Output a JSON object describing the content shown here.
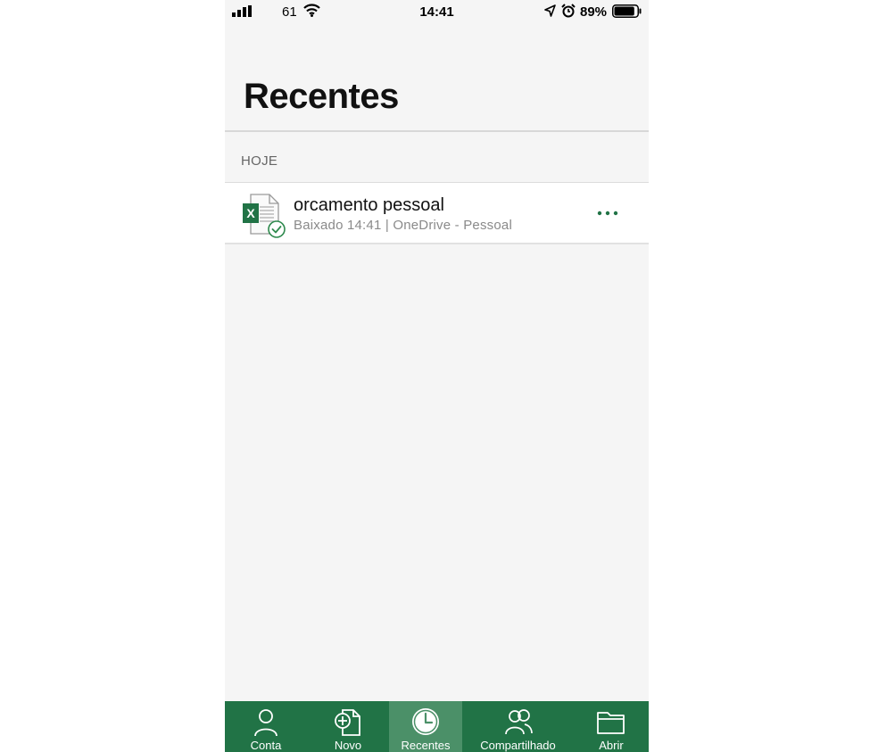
{
  "status_bar": {
    "carrier": "61",
    "time": "14:41",
    "battery_percent": "89%",
    "battery_level": 0.89
  },
  "header": {
    "title": "Recentes"
  },
  "section": {
    "label": "HOJE"
  },
  "files": [
    {
      "name": "orcamento pessoal",
      "meta": "Baixado 14:41 | OneDrive - Pessoal",
      "type_icon": "excel-file-icon",
      "sync_status": "synced-check-icon"
    }
  ],
  "tabs": [
    {
      "label": "Conta",
      "icon": "person-icon",
      "active": false
    },
    {
      "label": "Novo",
      "icon": "new-document-icon",
      "active": false
    },
    {
      "label": "Recentes",
      "icon": "clock-icon",
      "active": true
    },
    {
      "label": "Compartilhado",
      "icon": "people-icon",
      "active": false
    },
    {
      "label": "Abrir",
      "icon": "folder-icon",
      "active": false
    }
  ],
  "colors": {
    "accent": "#217346",
    "accent_active": "#4b9068",
    "background": "#f5f5f5"
  }
}
